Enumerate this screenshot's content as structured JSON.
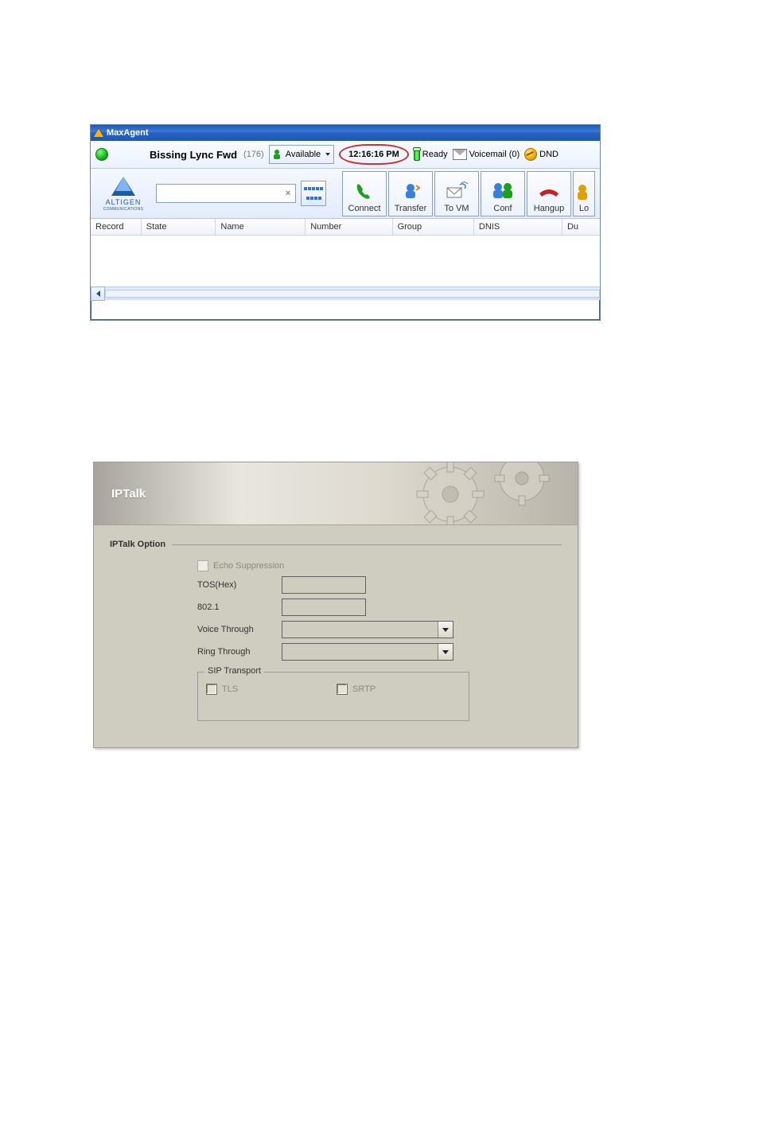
{
  "maxagent": {
    "windowTitle": "MaxAgent",
    "user": "Bissing Lync Fwd",
    "ext": "(176)",
    "availability": "Available",
    "time": "12:16:16 PM",
    "readyLabel": "Ready",
    "voicemailLabel": "Voicemail (0)",
    "dndLabel": "DND",
    "brand": "ALTIGEN",
    "brandSub": "COMMUNICATIONS",
    "buttons": {
      "connect": "Connect",
      "transfer": "Transfer",
      "tovm": "To VM",
      "conf": "Conf",
      "hangup": "Hangup",
      "partial": "Lo"
    },
    "columns": {
      "record": "Record",
      "state": "State",
      "name": "Name",
      "number": "Number",
      "group": "Group",
      "dnis": "DNIS",
      "du": "Du"
    }
  },
  "iptalk": {
    "headerTitle": "IPTalk",
    "sectionLabel": "IPTalk Option",
    "echo": "Echo Suppression",
    "tos": "TOS(Hex)",
    "p8021": "802.1",
    "voice": "Voice Through",
    "ring": "Ring Through",
    "siptransport": "SIP Transport",
    "tls": "TLS",
    "srtp": "SRTP"
  }
}
